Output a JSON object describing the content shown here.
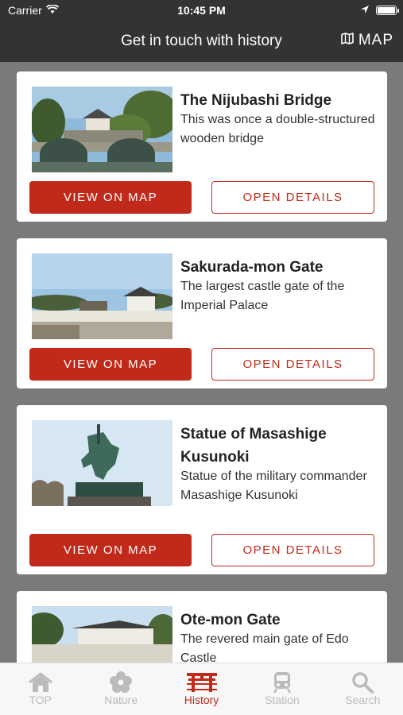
{
  "status": {
    "carrier": "Carrier",
    "time": "10:45 PM"
  },
  "navbar": {
    "title": "Get in touch with history",
    "map_label": "MAP"
  },
  "cards": [
    {
      "title": "The Nijubashi Bridge",
      "description": "This was once a double-structured wooden bridge",
      "map_button": "VIEW ON MAP",
      "details_button": "OPEN DETAILS"
    },
    {
      "title": "Sakurada-mon Gate",
      "description": "The largest castle gate of the Imperial Palace",
      "map_button": "VIEW ON MAP",
      "details_button": "OPEN DETAILS"
    },
    {
      "title": "Statue of Masashige Kusunoki",
      "description": "Statue of the military commander Masashige Kusunoki",
      "map_button": "VIEW ON MAP",
      "details_button": "OPEN DETAILS"
    },
    {
      "title": "Ote-mon Gate",
      "description": "The revered main gate of Edo Castle"
    }
  ],
  "tabs": [
    {
      "label": "TOP",
      "icon": "home-icon"
    },
    {
      "label": "Nature",
      "icon": "flower-icon"
    },
    {
      "label": "History",
      "icon": "torii-icon",
      "active": true
    },
    {
      "label": "Station",
      "icon": "train-icon"
    },
    {
      "label": "Search",
      "icon": "search-icon"
    }
  ],
  "colors": {
    "accent": "#c12a1a",
    "bar": "#333333",
    "background": "#7a7a7a"
  }
}
